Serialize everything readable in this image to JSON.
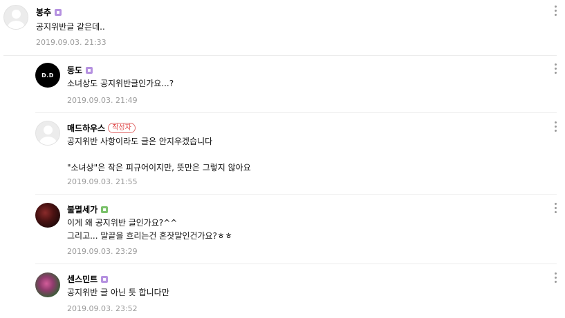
{
  "comments": [
    {
      "author": "봉추",
      "text": "공지위반글 같은데..",
      "date": "2019.09.03. 21:33"
    },
    {
      "author": "동도",
      "avatar_text": "D.D",
      "text": "소녀상도 공지위반글인가요...?",
      "date": "2019.09.03. 21:49"
    },
    {
      "author": "매드하우스",
      "author_badge": "작성자",
      "text": "공지위반 사항이라도 글은 안지우겠습니다\n\n\"소녀상\"은 작은 피규어이지만, 뜻만은 그렇지 않아요",
      "date": "2019.09.03. 21:55"
    },
    {
      "author": "불멸세가",
      "text": "이게 왜 공지위반 글인가요?^^\n그리고... 말끝을 흐리는건 혼잣말인건가요?ㅎㅎ",
      "date": "2019.09.03. 23:29"
    },
    {
      "author": "센스민트",
      "text": "공지위반 글 아닌 듯 합니다만",
      "date": "2019.09.03. 23:52"
    }
  ],
  "colors": {
    "level_purple": "#b591e0",
    "level_green": "#7ac16a",
    "author_badge": "#e04848"
  },
  "icons": {
    "menu": "more-vertical-icon",
    "level": "level-badge-icon"
  }
}
